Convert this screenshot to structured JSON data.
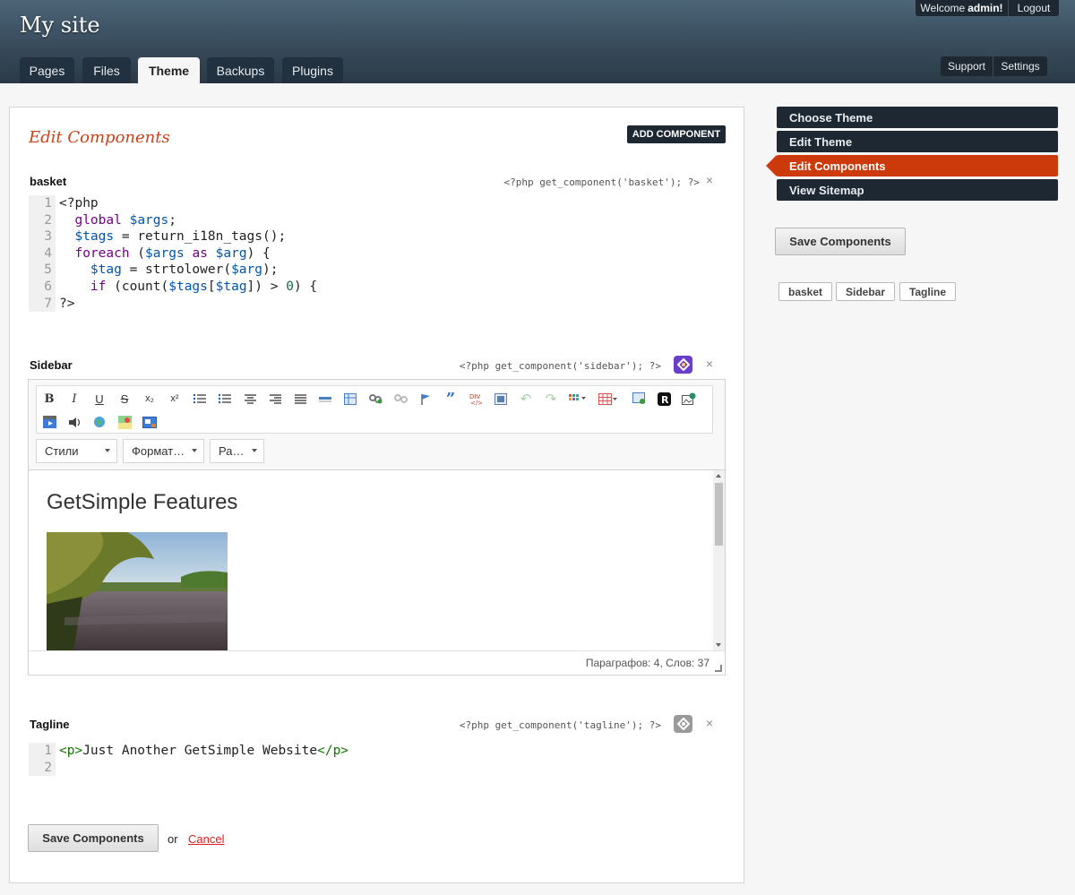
{
  "header": {
    "site_title": "My site",
    "welcome_prefix": "Welcome",
    "welcome_user": "admin!",
    "logout_label": "Logout",
    "support_label": "Support",
    "settings_label": "Settings",
    "tabs": [
      {
        "label": "Pages"
      },
      {
        "label": "Files"
      },
      {
        "label": "Theme",
        "active": true
      },
      {
        "label": "Backups"
      },
      {
        "label": "Plugins"
      }
    ]
  },
  "main": {
    "title": "Edit Components",
    "add_component_label": "ADD COMPONENT",
    "components": [
      {
        "title": "basket",
        "code_snippet": "<?php get_component('basket'); ?>",
        "close_label": "×"
      },
      {
        "title": "Sidebar",
        "code_snippet": "<?php get_component('sidebar'); ?>",
        "close_label": "×"
      },
      {
        "title": "Tagline",
        "code_snippet": "<?php get_component('tagline'); ?>",
        "close_label": "×"
      }
    ],
    "basket_line_numbers": [
      "1",
      "2",
      "3",
      "4",
      "5",
      "6",
      "7"
    ],
    "tagline_line_numbers": [
      "1",
      "2"
    ],
    "tagline_code": {
      "open_tag": "<p>",
      "text": "Just Another GetSimple Website",
      "close_tag": "</p>"
    },
    "editor": {
      "combo_styles": "Стили",
      "combo_format": "Формат…",
      "combo_size": "Ра…",
      "content_heading": "GetSimple Features",
      "status_text": "Параграфов: 4, Слов: 37"
    },
    "save_label": "Save Components",
    "or_label": "or",
    "cancel_label": "Cancel"
  },
  "sidebar": {
    "items": [
      {
        "label": "Choose Theme"
      },
      {
        "label": "Edit Theme"
      },
      {
        "label": "Edit Components",
        "active": true
      },
      {
        "label": "View Sitemap"
      }
    ],
    "save_label": "Save Components",
    "component_chips": [
      "basket",
      "Sidebar",
      "Tagline"
    ]
  },
  "colors": {
    "accent": "#cc3a0b",
    "dark_nav": "#1d2832",
    "title_orange": "#c8431a",
    "cancel_red": "#dd2222"
  }
}
